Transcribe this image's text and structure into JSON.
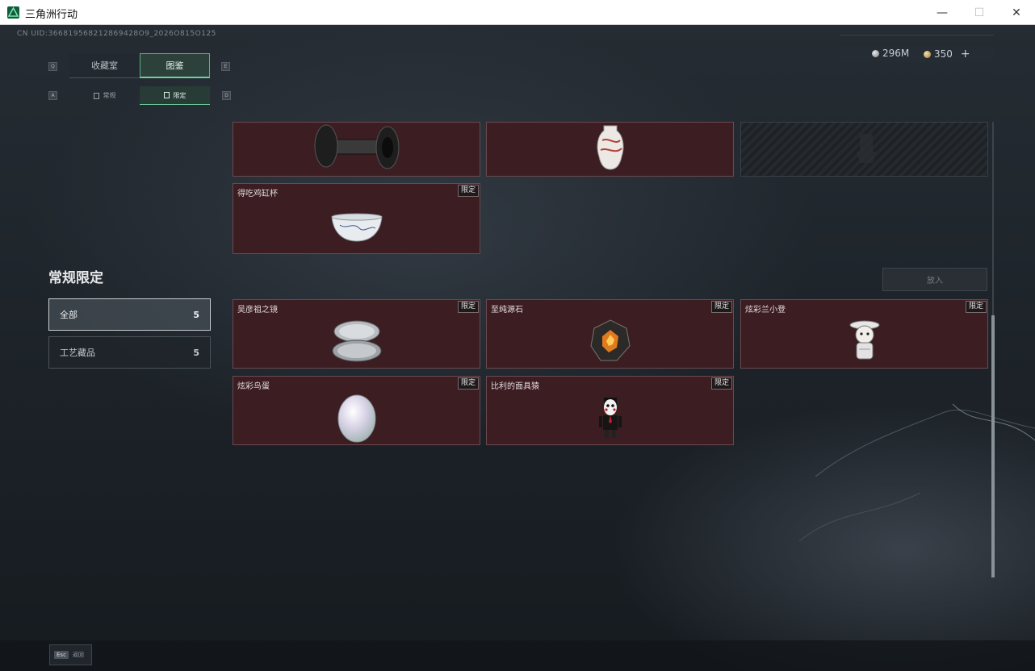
{
  "window": {
    "title": "三角洲行动",
    "minimize_glyph": "—",
    "maximize_glyph": "☐",
    "close_glyph": "✕"
  },
  "uid": "CN UID:366819568212869428O9_2026O815O125",
  "currency": {
    "silver": "296M",
    "gold": "350",
    "add_glyph": "+"
  },
  "keys": {
    "prev_tab": "Q",
    "next_tab": "E",
    "prev_sub": "A",
    "next_sub": "D"
  },
  "tabs": [
    {
      "label": "收藏室"
    },
    {
      "label": "图鉴"
    }
  ],
  "subtabs": [
    {
      "label": "常规"
    },
    {
      "label": "限定"
    }
  ],
  "section": {
    "title": "常规限定"
  },
  "filters": [
    {
      "label": "全部",
      "count": "5"
    },
    {
      "label": "工艺藏品",
      "count": "5"
    }
  ],
  "put_button": "放入",
  "top_cards": [
    {
      "name": "得吃鸡缸杯",
      "tag": "限定"
    }
  ],
  "items": [
    {
      "name": "吴彦祖之镜",
      "tag": "限定"
    },
    {
      "name": "至纯源石",
      "tag": "限定"
    },
    {
      "name": "炫彩兰小登",
      "tag": "限定"
    },
    {
      "name": "炫彩鸟蛋",
      "tag": "限定"
    },
    {
      "name": "比利的面具猿",
      "tag": "限定"
    }
  ],
  "esc": {
    "key": "Esc",
    "label": "返回"
  },
  "colors": {
    "accent": "#6fcf9e",
    "card_bg": "#3b1d22",
    "card_border": "#6b4a4f"
  }
}
